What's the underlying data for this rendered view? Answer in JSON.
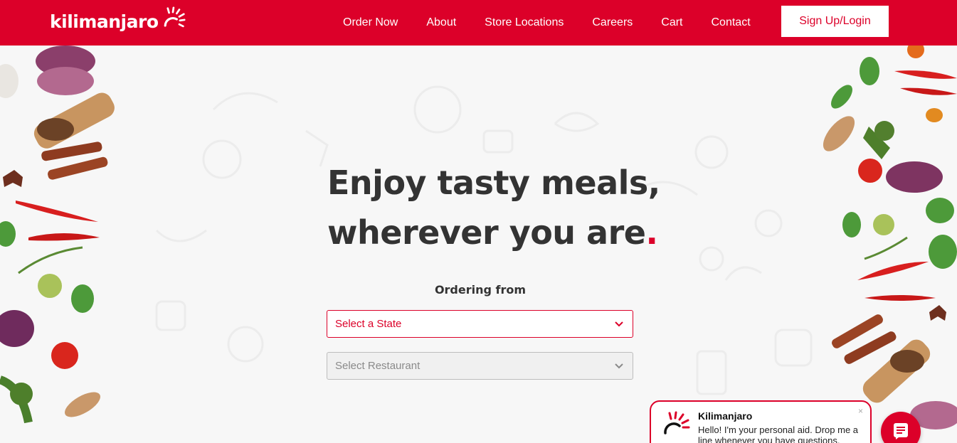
{
  "brand": {
    "name": "kilimanjaro",
    "accent": "#dc0029"
  },
  "nav": {
    "items": [
      {
        "label": "Order Now"
      },
      {
        "label": "About"
      },
      {
        "label": "Store Locations"
      },
      {
        "label": "Careers"
      },
      {
        "label": "Cart"
      },
      {
        "label": "Contact"
      }
    ],
    "signup_label": "Sign Up/Login"
  },
  "hero": {
    "headline_line1": "Enjoy tasty meals,",
    "headline_line2": "wherever you are",
    "headline_dot": ".",
    "ordering_label": "Ordering from",
    "state_select": {
      "value": "Select a State",
      "icon": "chevron-down-icon"
    },
    "restaurant_select": {
      "value": "Select Restaurant",
      "icon": "chevron-down-icon",
      "disabled": true
    }
  },
  "chat": {
    "name": "Kilimanjaro",
    "message": "Hello! I'm your personal aid. Drop me a line whenever you have questions.",
    "close_icon": "×",
    "fab_icon": "chat-icon"
  }
}
